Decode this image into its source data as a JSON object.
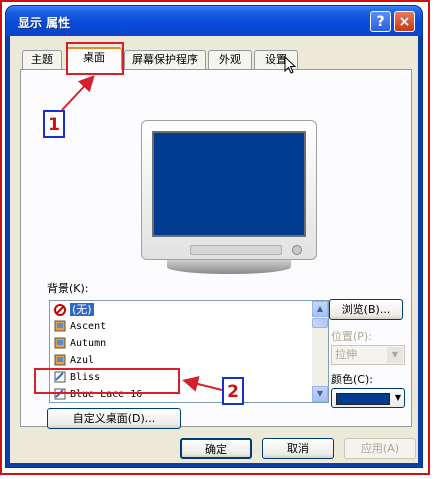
{
  "window": {
    "title": "显示 属性",
    "help": "?",
    "close": "×"
  },
  "tabs": [
    {
      "label": "主题"
    },
    {
      "label": "桌面"
    },
    {
      "label": "屏幕保护程序"
    },
    {
      "label": "外观"
    },
    {
      "label": "设置"
    }
  ],
  "background": {
    "label": "背景(K):",
    "items": [
      "(无)",
      "Ascent",
      "Autumn",
      "Azul",
      "Bliss",
      "Blue Lace 16"
    ],
    "selected": "(无)"
  },
  "browse_button": "浏览(B)...",
  "position": {
    "label": "位置(P):",
    "value": "拉伸"
  },
  "color": {
    "label": "颜色(C):",
    "value": "#003c8f"
  },
  "customize_button": "自定义桌面(D)...",
  "footer": {
    "ok": "确定",
    "cancel": "取消",
    "apply": "应用(A)"
  },
  "callouts": [
    "1",
    "2"
  ],
  "colors": {
    "annotation": "#d8202a",
    "callout_border": "#1a2fd0",
    "desktop": "#003c8f"
  }
}
